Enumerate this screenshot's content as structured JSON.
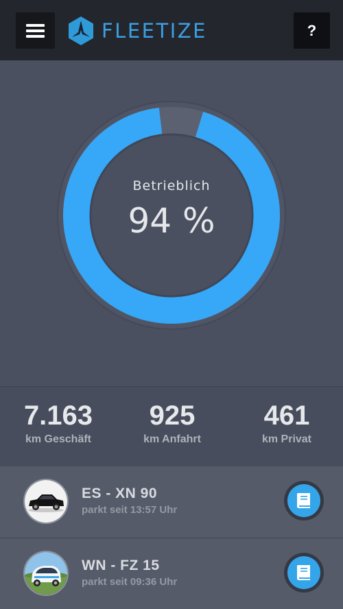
{
  "header": {
    "brand": "FLEETIZE",
    "help_label": "?",
    "menu_icon": "hamburger-icon",
    "logo_icon": "fleetize-hexagon-logo"
  },
  "gauge": {
    "label": "Betrieblich",
    "value_text": "94 %",
    "percent": 94,
    "color_fill": "#37a7f7",
    "color_track": "#5b6170"
  },
  "stats": [
    {
      "value": "7.163",
      "label": "km Geschäft"
    },
    {
      "value": "925",
      "label": "km Anfahrt"
    },
    {
      "value": "461",
      "label": "km Privat"
    }
  ],
  "vehicles": [
    {
      "plate": "ES - XN 90",
      "status": "parkt seit 13:57 Uhr",
      "icon": "logbook-icon"
    },
    {
      "plate": "WN - FZ 15",
      "status": "parkt seit 09:36 Uhr",
      "icon": "logbook-icon"
    }
  ],
  "colors": {
    "accent": "#37a7f7",
    "header_bg": "#23262d",
    "body_bg": "#474d5c"
  }
}
